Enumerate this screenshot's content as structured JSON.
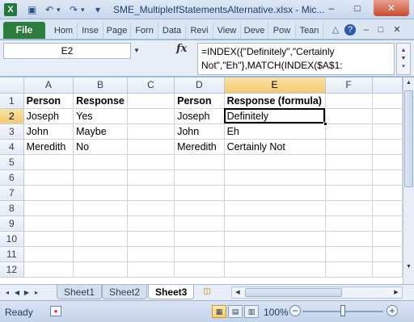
{
  "window": {
    "title": "SME_MultipleIfStatementsAlternative.xlsx - Mic...",
    "logo": "X",
    "min_icon": "minimize-icon",
    "max_icon": "maximize-icon",
    "close_icon": "close-icon",
    "min_glyph": "–",
    "max_glyph": "□",
    "close_glyph": "✕"
  },
  "qat": {
    "save_glyph": "▣",
    "undo_glyph": "↶",
    "redo_glyph": "↷",
    "customize_glyph": "▾"
  },
  "ribbon": {
    "file_label": "File",
    "tabs": [
      "Hom",
      "Inse",
      "Page",
      "Forn",
      "Data",
      "Revi",
      "View",
      "Deve",
      "Pow",
      "Tean"
    ],
    "right_icons": [
      "△",
      "?",
      "–",
      "□",
      "✕"
    ]
  },
  "formula_bar": {
    "name_box": "E2",
    "fx_label": "fx",
    "formula": "=INDEX({\"Definitely\",\"Certainly Not\",\"Eh\"},MATCH(INDEX($A$1:"
  },
  "grid": {
    "columns": [
      "A",
      "B",
      "C",
      "D",
      "E",
      "F"
    ],
    "selected_column": "E",
    "selected_row": 2,
    "rows": [
      {
        "num": "1",
        "cells": [
          "Person",
          "Response",
          "",
          "Person",
          "Response (formula)",
          ""
        ],
        "bold": true
      },
      {
        "num": "2",
        "cells": [
          "Joseph",
          "Yes",
          "",
          "Joseph",
          "Definitely",
          ""
        ]
      },
      {
        "num": "3",
        "cells": [
          "John",
          "Maybe",
          "",
          "John",
          "Eh",
          ""
        ]
      },
      {
        "num": "4",
        "cells": [
          "Meredith",
          "No",
          "",
          "Meredith",
          "Certainly Not",
          ""
        ]
      },
      {
        "num": "5",
        "cells": [
          "",
          "",
          "",
          "",
          "",
          ""
        ]
      },
      {
        "num": "6",
        "cells": [
          "",
          "",
          "",
          "",
          "",
          ""
        ]
      },
      {
        "num": "7",
        "cells": [
          "",
          "",
          "",
          "",
          "",
          ""
        ]
      },
      {
        "num": "8",
        "cells": [
          "",
          "",
          "",
          "",
          "",
          ""
        ]
      },
      {
        "num": "9",
        "cells": [
          "",
          "",
          "",
          "",
          "",
          ""
        ]
      },
      {
        "num": "10",
        "cells": [
          "",
          "",
          "",
          "",
          "",
          ""
        ]
      },
      {
        "num": "11",
        "cells": [
          "",
          "",
          "",
          "",
          "",
          ""
        ]
      },
      {
        "num": "12",
        "cells": [
          "",
          "",
          "",
          "",
          "",
          ""
        ]
      }
    ]
  },
  "sheets": {
    "tabs": [
      "Sheet1",
      "Sheet2",
      "Sheet3"
    ],
    "active": "Sheet3",
    "nav_glyphs": [
      "◂",
      "◀",
      "▶",
      "▸"
    ]
  },
  "status": {
    "ready": "Ready",
    "zoom": "100%",
    "zoom_minus": "−",
    "zoom_plus": "+",
    "zoom_level": 0.5
  }
}
